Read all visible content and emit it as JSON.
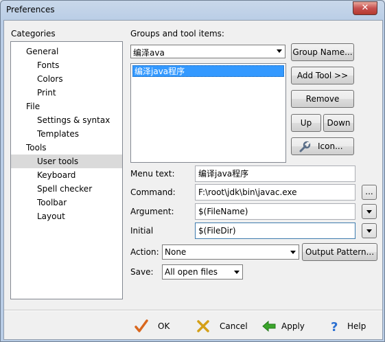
{
  "window": {
    "title": "Preferences",
    "close_glyph": "✕"
  },
  "categories": {
    "label": "Categories",
    "items": [
      {
        "label": "General",
        "level": 1,
        "selected": false
      },
      {
        "label": "Fonts",
        "level": 2,
        "selected": false
      },
      {
        "label": "Colors",
        "level": 2,
        "selected": false
      },
      {
        "label": "Print",
        "level": 2,
        "selected": false
      },
      {
        "label": "File",
        "level": 1,
        "selected": false
      },
      {
        "label": "Settings & syntax",
        "level": 2,
        "selected": false
      },
      {
        "label": "Templates",
        "level": 2,
        "selected": false
      },
      {
        "label": "Tools",
        "level": 1,
        "selected": false
      },
      {
        "label": "User tools",
        "level": 2,
        "selected": true
      },
      {
        "label": "Keyboard",
        "level": 2,
        "selected": false
      },
      {
        "label": "Spell checker",
        "level": 2,
        "selected": false
      },
      {
        "label": "Toolbar",
        "level": 2,
        "selected": false
      },
      {
        "label": "Layout",
        "level": 2,
        "selected": false
      }
    ]
  },
  "groups": {
    "label": "Groups and tool items:",
    "group_value": "编泽ava",
    "list_items": [
      "编泽java程序"
    ],
    "buttons": {
      "group_name": "Group Name...",
      "add_tool": "Add Tool >>",
      "remove": "Remove",
      "up": "Up",
      "down": "Down",
      "icon": "Icon..."
    }
  },
  "fields": {
    "menu_text": {
      "label": "Menu text:",
      "value": "编译java程序"
    },
    "command": {
      "label": "Command:",
      "value": "F:\\root\\jdk\\bin\\javac.exe",
      "browse": "..."
    },
    "argument": {
      "label": "Argument:",
      "value": "$(FileName)"
    },
    "initial": {
      "label": "Initial",
      "value": "$(FileDir)"
    },
    "action": {
      "label": "Action:",
      "value": "None",
      "output_pattern": "Output Pattern..."
    },
    "save": {
      "label": "Save:",
      "value": "All open files"
    }
  },
  "footer": {
    "ok": "OK",
    "cancel": "Cancel",
    "apply": "Apply",
    "help": "Help"
  },
  "colors": {
    "selection": "#3399ff",
    "ok_check": "#d9671e",
    "cancel_x": "#d4a017",
    "apply_arrow": "#3aa52b",
    "help_q": "#2a6fd1"
  },
  "icons": {
    "ok": "check-icon",
    "cancel": "x-icon",
    "apply": "green-arrow-left-icon",
    "help": "question-mark-icon",
    "tool": "wrench-icon"
  }
}
